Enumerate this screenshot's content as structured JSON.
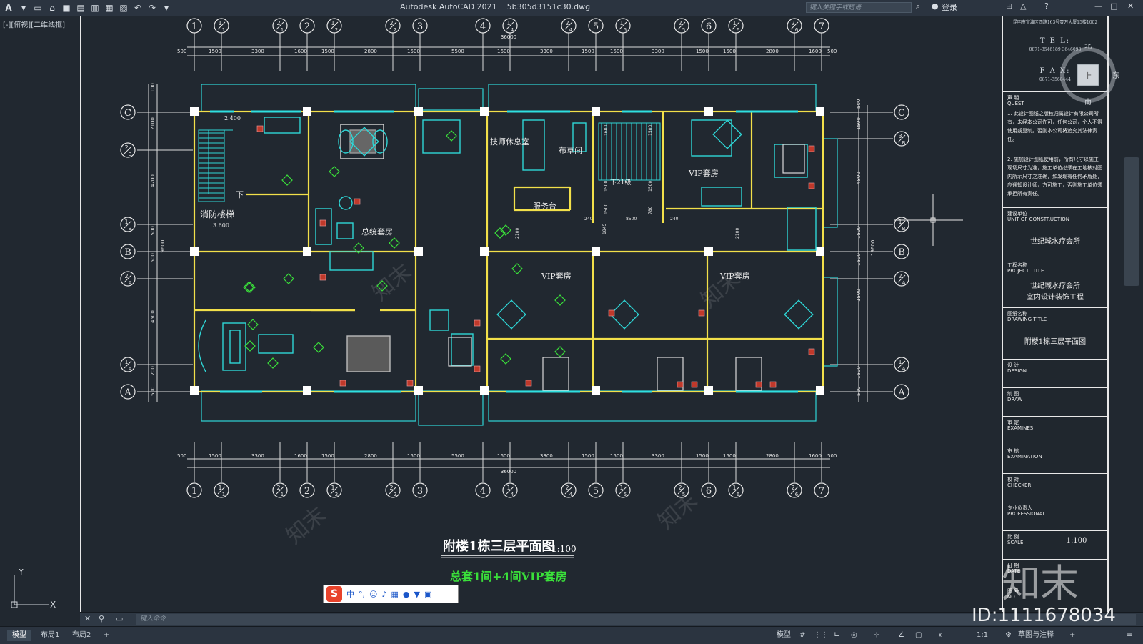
{
  "window": {
    "title": "Autodesk AutoCAD 2021",
    "filename": "5b305d3151c30.dwg",
    "search_placeholder": "键入关键字或短语",
    "login": "登录"
  },
  "viewport_label": "[-][俯视][二维线框]",
  "ucs": {
    "y": "Y",
    "x": "X"
  },
  "grid_axes": {
    "top": [
      "1",
      "1/1",
      "2/1",
      "2",
      "1/2",
      "2/2",
      "3",
      "4",
      "1/4",
      "2/4",
      "5",
      "1/5",
      "2/5",
      "6",
      "1/6",
      "2/6",
      "7"
    ],
    "left": [
      "C",
      "2/B",
      "1/B",
      "B",
      "2/A",
      "1/A",
      "A"
    ],
    "right": [
      "C",
      "3/B",
      "1/B",
      "B",
      "2/A",
      "1/A",
      "A"
    ]
  },
  "dimensions": {
    "top_total": "36000",
    "segments": [
      "500",
      "1500",
      "3300",
      "1600",
      "1500",
      "2800",
      "1500",
      "5500",
      "1600",
      "3300",
      "1500",
      "1500",
      "3300",
      "1500",
      "1500",
      "2800",
      "1600",
      "500"
    ],
    "left_segments": [
      "1100",
      "2100",
      "4200",
      "1500",
      "1500",
      "4500",
      "1200",
      "500"
    ],
    "left_total": "19600",
    "right_segments": [
      "500",
      "1500",
      "4800",
      "1500",
      "1500",
      "1500",
      "1500",
      "500"
    ],
    "right_total": "19600"
  },
  "rooms": [
    {
      "label": "消防楼梯",
      "sub": "3.600"
    },
    {
      "label": "2.400"
    },
    {
      "label": "下"
    },
    {
      "label": "总统套房"
    },
    {
      "label": "技师休息室"
    },
    {
      "label": "布草间"
    },
    {
      "label": "服务台"
    },
    {
      "label": "下21级"
    },
    {
      "label": "VIP套房"
    },
    {
      "label": "VIP套房"
    },
    {
      "label": "VIP套房"
    }
  ],
  "inner_dims": [
    "240",
    "8500",
    "240",
    "1845",
    "2100",
    "2100",
    "1600",
    "1500",
    "1500",
    "1500",
    "1500",
    "1500",
    "780"
  ],
  "drawing_title": "附楼1栋三层平面图",
  "drawing_scale": "1:100",
  "drawing_subtitle": "总套1间+4间VIP套房",
  "title_block": {
    "address": "昆明市官渡区西路163号壹万大厦15楼1002",
    "tel_label": "T E L:",
    "tel": "0871-3546189 3646093",
    "fax_label": "F A X:",
    "fax": "0871-3568444",
    "notes_label": "声 明\nQUEST",
    "notes": [
      "1. 此设计图纸之版权归属设计有限公司所有，未经本公司许可，任何公司，个人不得使用或复制。否则本公司将追究其法律责任。",
      "2. 施加设计图纸使用前，所有尺寸以施工现场尺寸为准，施工单位必须在工地核对图内所示尺寸之准确，如发现有任何矛盾处，应通知设计师，方可施工，否则施工单位须承担所有责任。"
    ],
    "unit_label": "建设单位\nUNIT OF CONSTRUCTION",
    "unit_value": "世纪城水疗会所",
    "project_label": "工程名称\nPROJECT TITLE",
    "project_value_1": "世纪城水疗会所",
    "project_value_2": "室内设计装饰工程",
    "drawing_label": "图纸名称\nDRAWING TITLE",
    "drawing_value": "附楼1栋三层平面图",
    "design_label": "设 计\nDESIGN",
    "draw_label": "制 图\nDRAW",
    "exam_label": "审 定\nEXAMINES",
    "exam2_label": "审 核\nEXAMINATION",
    "checker_label": "校 对\nCHECKER",
    "pro_label": "专业负责人\nPROFESSIONAL",
    "scale_label": "比 例\nSCALE",
    "scale_value": "1:100",
    "date_label": "日 期\nDATE",
    "no_label": "图 号\nNO."
  },
  "viewcube": {
    "north": "北",
    "east": "东",
    "south": "南",
    "face": "上"
  },
  "command_placeholder": "键入命令",
  "ime_label": "中",
  "layout_tabs": [
    "模型",
    "布局1",
    "布局2"
  ],
  "status": {
    "model": "模型",
    "scale": "1:1",
    "workspace": "草图与注释"
  },
  "watermark_logo": "知末",
  "watermark_id": "ID:1111678034",
  "colors": {
    "wall": "#f5e65a",
    "window": "#2fe0e0",
    "tag": "#3adf3a",
    "dim": "#e6e6e6",
    "bg": "#212830"
  }
}
